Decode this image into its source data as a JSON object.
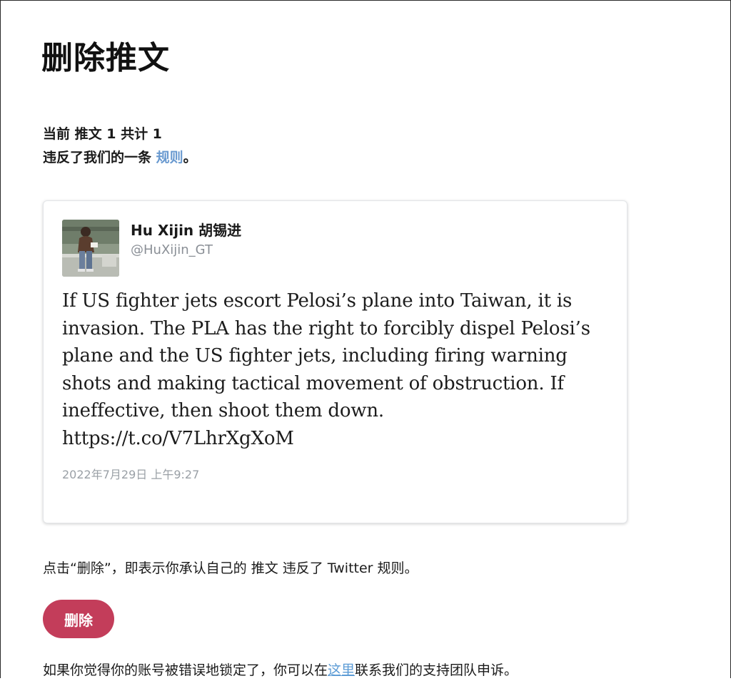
{
  "page": {
    "title": "删除推文"
  },
  "summary": {
    "counter": "当前 推文 1 共计 1",
    "violation_prefix": "违反了我们的一条 ",
    "rules_link": "规则",
    "violation_suffix": "。"
  },
  "tweet": {
    "author_name": "Hu Xijin 胡锡进",
    "author_handle": "@HuXijin_GT",
    "avatar_icon": "user-avatar-photo",
    "text": "If US fighter jets escort Pelosi’s plane into Taiwan, it is invasion. The PLA has the right to forcibly dispel Pelosi’s plane and the US fighter jets, including firing warning shots and making tactical movement of obstruction. If ineffective, then shoot them down.",
    "link": "https://t.co/V7LhrXgXoM",
    "date": "2022年7月29日 上午9:27"
  },
  "confirm": {
    "text": "点击“删除”，即表示你承认自己的 推文 违反了 Twitter 规则。"
  },
  "actions": {
    "delete_label": "删除"
  },
  "appeal": {
    "prefix": "如果你觉得你的账号被错误地锁定了，你可以在",
    "link": "这里",
    "suffix": "联系我们的支持团队申诉。"
  },
  "colors": {
    "delete_button": "#c33d5a",
    "link": "#6a9ad0",
    "handle": "#8a8f96"
  }
}
